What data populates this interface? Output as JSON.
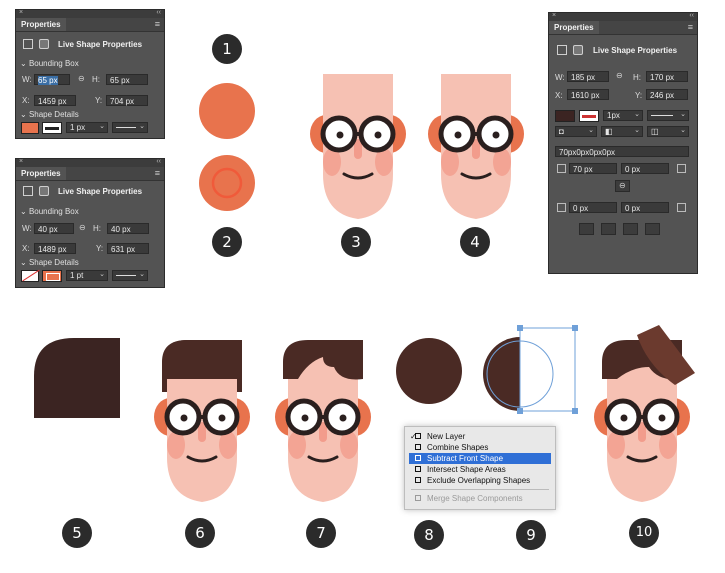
{
  "panel_common": {
    "close_glyph": "×",
    "collapse_glyph": "‹‹",
    "tab_label": "Properties",
    "menu_glyph": "≡",
    "heading": "Live Shape Properties",
    "bounding_box": "Bounding Box",
    "shape_details": "Shape Details",
    "w_label": "W:",
    "h_label": "H:",
    "x_label": "X:",
    "y_label": "Y:"
  },
  "panel1": {
    "w": "65 px",
    "h": "65 px",
    "x": "1459 px",
    "y": "704 px",
    "stroke": "1 px",
    "fill_color": "#e8734d"
  },
  "panel2": {
    "w": "40 px",
    "h": "40 px",
    "x": "1489 px",
    "y": "631 px",
    "stroke": "1 pt",
    "stroke_color": "#e8734d"
  },
  "panel3": {
    "w": "185 px",
    "h": "170 px",
    "x": "1610 px",
    "y": "246 px",
    "stroke": "1px",
    "corners": "70px0px0px0px",
    "tl": "70 px",
    "tr": "0 px",
    "bl": "0 px",
    "br": "0 px",
    "fill_color": "#3b2422"
  },
  "steps": [
    "1",
    "2",
    "3",
    "4",
    "5",
    "6",
    "7",
    "8",
    "9",
    "10"
  ],
  "context_menu": {
    "items": [
      "New Layer",
      "Combine Shapes",
      "Subtract Front Shape",
      "Intersect Shape Areas",
      "Exclude Overlapping Shapes"
    ],
    "disabled": "Merge Shape Components",
    "check": "✓"
  },
  "colors": {
    "skin": "#f6c1b3",
    "cheek": "#f29c8c",
    "ear": "#e8734d",
    "hair": "#4a2a24",
    "hair_dark": "#3b2422",
    "glasses": "#2a1f1e",
    "accent": "#e8734d",
    "panel": "#535353"
  }
}
